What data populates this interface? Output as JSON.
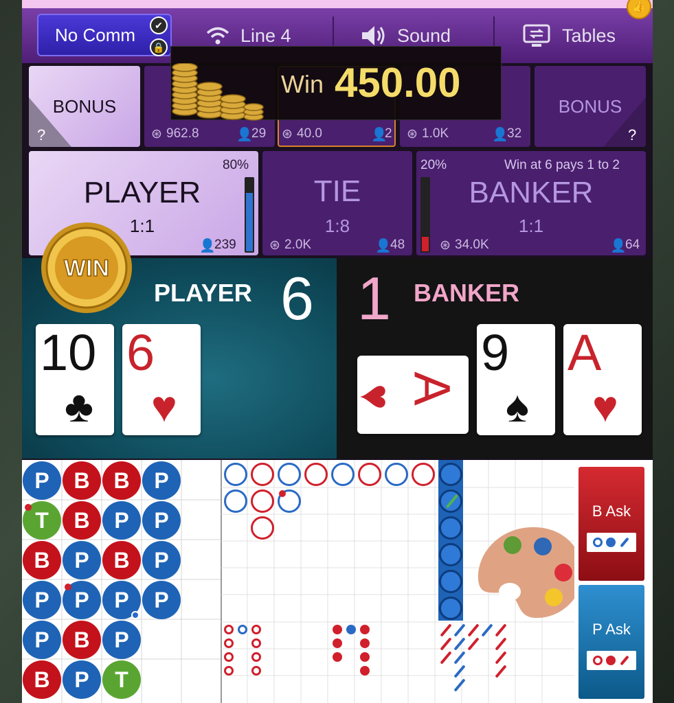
{
  "toolbar": {
    "no_comm_label": "No Comm",
    "line_label": "Line 4",
    "sound_label": "Sound",
    "tables_label": "Tables"
  },
  "win_popup": {
    "label": "Win",
    "amount": "450.00"
  },
  "bonus_left": {
    "label": "BONUS",
    "help": "?"
  },
  "bonus_right": {
    "label": "BONUS",
    "help": "?"
  },
  "side_bets": [
    {
      "amount": "962.8",
      "players": "29"
    },
    {
      "amount": "40.0",
      "players": "2"
    },
    {
      "amount": "1.0K",
      "players": "32"
    }
  ],
  "player_bet": {
    "label": "PLAYER",
    "odds": "1:1",
    "percent": "80%",
    "players": "239",
    "percent_fill": 0.8
  },
  "tie_bet": {
    "label": "TIE",
    "odds": "1:8",
    "amount": "2.0K",
    "players": "48"
  },
  "banker_bet": {
    "label": "BANKER",
    "odds": "1:1",
    "percent": "20%",
    "note": "Win at 6 pays 1 to 2",
    "amount": "34.0K",
    "players": "64",
    "percent_fill": 0.2
  },
  "result": {
    "win_badge": "WIN",
    "player_title": "PLAYER",
    "player_score": "6",
    "banker_title": "BANKER",
    "banker_score": "1",
    "player_cards": [
      {
        "rank": "10",
        "suit": "♣",
        "color": "black"
      },
      {
        "rank": "6",
        "suit": "♥",
        "color": "red"
      }
    ],
    "banker_cards": [
      {
        "rank": "A",
        "suit": "♥",
        "color": "red",
        "rotated": true
      },
      {
        "rank": "9",
        "suit": "♠",
        "color": "black"
      },
      {
        "rank": "A",
        "suit": "♥",
        "color": "red"
      }
    ]
  },
  "bead_road": [
    [
      "P",
      "T",
      "B",
      "P",
      "P",
      "B"
    ],
    [
      "B",
      "B",
      "P",
      "P",
      "B",
      "P"
    ],
    [
      "B",
      "P",
      "B",
      "P",
      "P",
      "T"
    ],
    [
      "P",
      "P",
      "P",
      "P",
      "",
      ""
    ]
  ],
  "ask_buttons": {
    "banker_ask": "B Ask",
    "player_ask": "P Ask"
  },
  "colors": {
    "player_blue": "#1e63b6",
    "banker_red": "#c4121c",
    "tie_green": "#5aa532",
    "purple": "#4a1f6e",
    "gold": "#f5dc6a"
  }
}
